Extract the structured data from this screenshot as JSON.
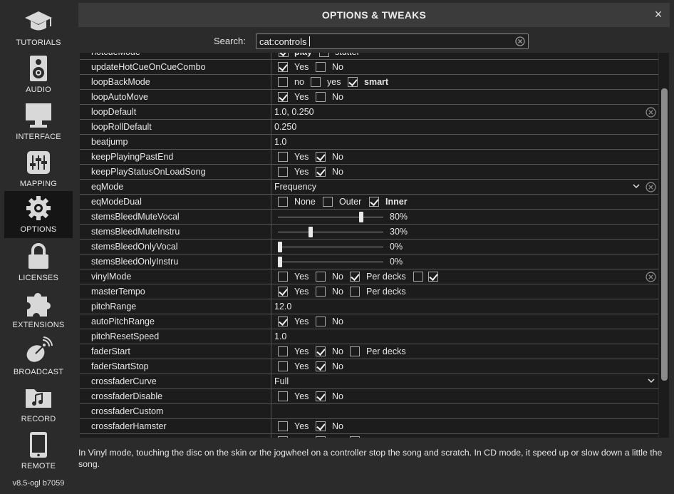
{
  "sidebar": {
    "items": [
      {
        "label": "TUTORIALS",
        "icon": "graduation-cap-icon"
      },
      {
        "label": "AUDIO",
        "icon": "speaker-icon"
      },
      {
        "label": "INTERFACE",
        "icon": "monitor-icon"
      },
      {
        "label": "MAPPING",
        "icon": "sliders-icon"
      },
      {
        "label": "OPTIONS",
        "icon": "gear-icon",
        "active": true
      },
      {
        "label": "LICENSES",
        "icon": "lock-icon"
      },
      {
        "label": "EXTENSIONS",
        "icon": "puzzle-icon"
      },
      {
        "label": "BROADCAST",
        "icon": "satellite-dish-icon"
      },
      {
        "label": "RECORD",
        "icon": "music-folder-icon"
      },
      {
        "label": "REMOTE",
        "icon": "phone-icon"
      }
    ],
    "version": "v8.5-ogl b7059"
  },
  "panel": {
    "title": "OPTIONS & TWEAKS",
    "close": "×"
  },
  "search": {
    "label": "Search:",
    "value": "cat:controls"
  },
  "rows": [
    {
      "name": "hotcueMode",
      "c1": "play",
      "c2": "stutter"
    },
    {
      "name": "updateHotCueOnCueCombo",
      "yes": "Yes",
      "no": "No"
    },
    {
      "name": "loopBackMode",
      "o1": "no",
      "o2": "yes",
      "o3": "smart"
    },
    {
      "name": "loopAutoMove",
      "yes": "Yes",
      "no": "No"
    },
    {
      "name": "loopDefault",
      "value": "1.0, 0.250"
    },
    {
      "name": "loopRollDefault",
      "value": "0.250"
    },
    {
      "name": "beatjump",
      "value": "1.0"
    },
    {
      "name": "keepPlayingPastEnd",
      "yes": "Yes",
      "no": "No"
    },
    {
      "name": "keepPlayStatusOnLoadSong",
      "yes": "Yes",
      "no": "No"
    },
    {
      "name": "eqMode",
      "value": "Frequency"
    },
    {
      "name": "eqModeDual",
      "o1": "None",
      "o2": "Outer",
      "o3": "Inner"
    },
    {
      "name": "stemsBleedMuteVocal",
      "value": "80%",
      "level": 0.8
    },
    {
      "name": "stemsBleedMuteInstru",
      "value": "30%",
      "level": 0.3
    },
    {
      "name": "stemsBleedOnlyVocal",
      "value": "0%",
      "level": 0.0
    },
    {
      "name": "stemsBleedOnlyInstru",
      "value": "0%",
      "level": 0.0
    },
    {
      "name": "vinylMode",
      "yes": "Yes",
      "no": "No",
      "per": "Per decks"
    },
    {
      "name": "masterTempo",
      "yes": "Yes",
      "no": "No",
      "per": "Per decks"
    },
    {
      "name": "pitchRange",
      "value": "12.0"
    },
    {
      "name": "autoPitchRange",
      "yes": "Yes",
      "no": "No"
    },
    {
      "name": "pitchResetSpeed",
      "value": "1.0"
    },
    {
      "name": "faderStart",
      "yes": "Yes",
      "no": "No",
      "per": "Per decks"
    },
    {
      "name": "faderStartStop",
      "yes": "Yes",
      "no": "No"
    },
    {
      "name": "crossfaderCurve",
      "value": "Full"
    },
    {
      "name": "crossfaderDisable",
      "yes": "Yes",
      "no": "No"
    },
    {
      "name": "crossfaderCustom",
      "value": ""
    },
    {
      "name": "crossfaderHamster",
      "yes": "Yes",
      "no": "No"
    }
  ],
  "help": "In Vinyl mode, touching the disc on the skin or the jogwheel on a controller stop the song and scratch. In CD mode, it speed up or slow down a little the song."
}
